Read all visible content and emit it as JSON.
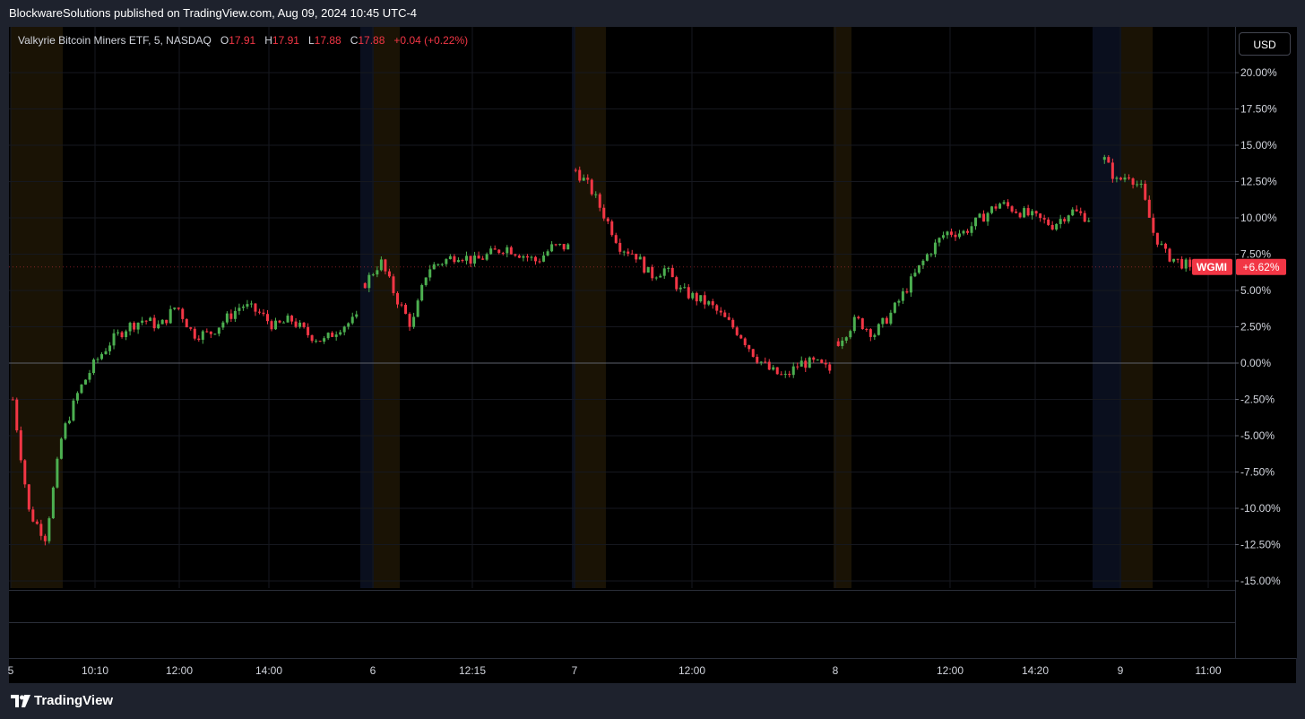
{
  "header": {
    "publisher_line": "BlockwareSolutions published on TradingView.com, Aug 09, 2024 10:45 UTC-4"
  },
  "legend": {
    "symbol": "Valkyrie Bitcoin Miners ETF, 5, NASDAQ",
    "o_label": "O",
    "o_value": "17.91",
    "h_label": "H",
    "h_value": "17.91",
    "l_label": "L",
    "l_value": "17.88",
    "c_label": "C",
    "c_value": "17.88",
    "change": "+0.04 (+0.22%)"
  },
  "currency_button": "USD",
  "footer": {
    "brand": "TradingView"
  },
  "colors": {
    "up": "#4caf50",
    "down": "#f23645",
    "background": "#000000",
    "panel": "#1e222d",
    "premarket_shade": "#1a1305",
    "postmarket_shade": "#0a0f1e"
  },
  "chart_data": {
    "type": "candlestick",
    "interval": "5 minute",
    "ticker": "WGMI",
    "last_label": "+6.62%",
    "y_axis": {
      "scale": "percentage",
      "ylim": [
        -15,
        21
      ],
      "ticks": [
        "20.00%",
        "17.50%",
        "15.00%",
        "12.50%",
        "10.00%",
        "7.50%",
        "5.00%",
        "2.50%",
        "0.00%",
        "-2.50%",
        "-5.00%",
        "-7.50%",
        "-10.00%",
        "-12.50%",
        "-15.00%"
      ]
    },
    "x_ticks": [
      "5",
      "10:10",
      "12:00",
      "14:00",
      "6",
      "12:15",
      "7",
      "12:00",
      "8",
      "12:00",
      "14:20",
      "9",
      "11:00"
    ],
    "grid": true,
    "day_trace": [
      {
        "day": "5",
        "points": [
          -2.5,
          -10.3,
          -12.0,
          -5.0,
          -2.0,
          0.0,
          1.5,
          2.5,
          3.0,
          2.5,
          4.0,
          2.0,
          2.0,
          3.0,
          4.0,
          3.5,
          2.5,
          3.0,
          2.0,
          1.5,
          2.5,
          3.0
        ]
      },
      {
        "day": "6",
        "points": [
          5.5,
          7.0,
          4.5,
          2.5,
          6.5,
          7.0,
          7.5,
          7.0,
          7.5,
          8.0,
          7.5,
          7.0,
          8.0,
          8.0
        ]
      },
      {
        "day": "7",
        "points": [
          13.3,
          12.0,
          10.0,
          8.0,
          7.5,
          6.0,
          6.5,
          5.0,
          4.5,
          4.0,
          3.0,
          2.0,
          0.5,
          -0.5,
          -1.0,
          0.0,
          0.0,
          -0.5
        ]
      },
      {
        "day": "8",
        "points": [
          1.5,
          3.0,
          2.0,
          3.5,
          5.5,
          7.5,
          9.0,
          9.0,
          10.0,
          11.0,
          10.5,
          10.0,
          9.5,
          10.5,
          10.0
        ]
      },
      {
        "day": "9",
        "points": [
          14.0,
          12.5,
          13.0,
          12.0,
          9.0,
          7.5,
          7.0,
          6.62
        ]
      }
    ],
    "candle_count": 290,
    "last_value": 6.62
  }
}
